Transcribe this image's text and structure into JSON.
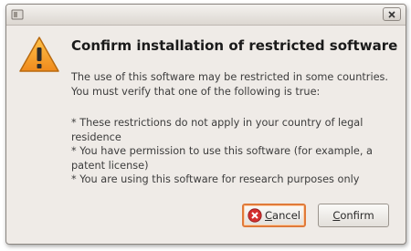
{
  "window": {
    "close_icon": "close-icon",
    "app_icon": "window-app-icon"
  },
  "dialog": {
    "icon": "warning-icon",
    "title": "Confirm installation of restricted software",
    "intro": "The use of this software may be restricted in some countries. You must verify that one of the following is true:",
    "items": [
      "* These restrictions do not apply in your country of legal residence",
      "* You have permission to use this software (for  example, a patent license)",
      "* You are using this software for research purposes only"
    ]
  },
  "buttons": {
    "cancel": {
      "mnemonic": "C",
      "rest": "ancel",
      "icon": "cancel-icon"
    },
    "confirm": {
      "mnemonic": "C",
      "rest": "onfirm"
    }
  },
  "colors": {
    "window_bg": "#efebe7",
    "warning_yellow": "#f5a623",
    "focus_ring": "#e07a3a",
    "cancel_icon_red": "#d32f2f"
  }
}
